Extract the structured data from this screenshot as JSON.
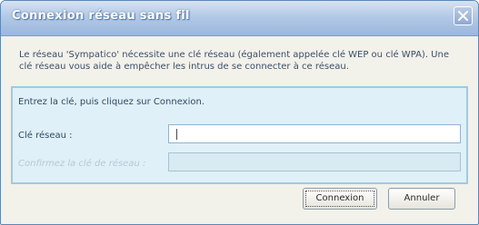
{
  "window": {
    "title": "Connexion réseau sans fil"
  },
  "description": "Le réseau 'Sympatico' nécessite une clé réseau (également appelée clé WEP ou clé WPA). Une clé réseau vous aide à empêcher les intrus de se connecter à ce réseau.",
  "form": {
    "instruction": "Entrez la clé, puis cliquez sur Connexion.",
    "key_label": "Clé réseau :",
    "key_value": "",
    "confirm_label": "Confirmez la clé de réseau :",
    "confirm_value": ""
  },
  "buttons": {
    "connect_label": "Connexion",
    "cancel_label": "Annuler"
  },
  "icons": {
    "close": "close-icon"
  },
  "colors": {
    "titlebar": "#b3c9e6",
    "group_background": "#dff0f8",
    "group_border": "#9ccbe2"
  }
}
